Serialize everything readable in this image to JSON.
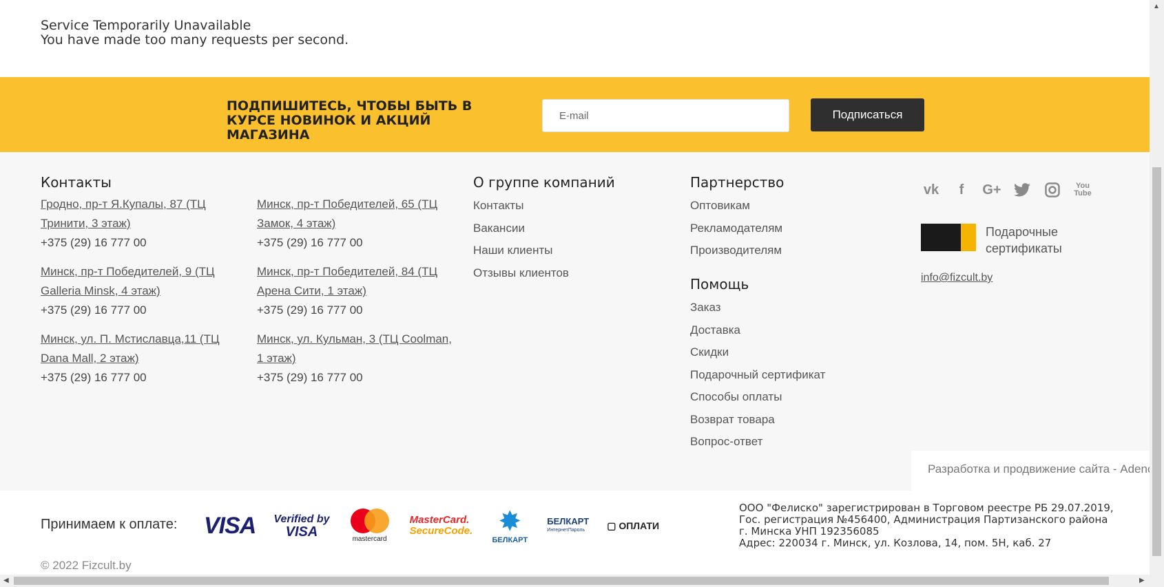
{
  "error": {
    "line1": "Service Temporarily Unavailable",
    "line2": "You have made too many requests per second."
  },
  "subscribe": {
    "title": "ПОДПИШИТЕСЬ, ЧТОБЫ БЫТЬ В КУРСЕ НОВИНОК И АКЦИЙ МАГАЗИНА",
    "email_placeholder": "E-mail",
    "button": "Подписаться",
    "bg_color": "#fbc02d"
  },
  "contacts": {
    "title": "Контакты",
    "stores": [
      {
        "address": "Гродно, пр-т Я.Купалы, 87 (ТЦ Тринити, 3 этаж)",
        "phone": "+375 (29) 16 777 00"
      },
      {
        "address": "Минск, пр-т Победителей, 65 (ТЦ Замок, 4 этаж)",
        "phone": "+375 (29) 16 777 00"
      },
      {
        "address": "Минск, пр-т Победителей, 9 (ТЦ Galleria Minsk, 4 этаж)",
        "phone": "+375 (29) 16 777 00"
      },
      {
        "address": "Минск, пр-т Победителей, 84 (ТЦ Арена Сити, 1 этаж)",
        "phone": "+375 (29) 16 777 00"
      },
      {
        "address": "Минск, ул. П. Мстиславца,11 (ТЦ Dana Mall, 2 этаж)",
        "phone": "+375 (29) 16 777 00"
      },
      {
        "address": "Минск, ул. Кульман, 3 (ТЦ Coolman, 1 этаж)",
        "phone": "+375 (29) 16 777 00"
      }
    ]
  },
  "about": {
    "title": "О группе компаний",
    "links": [
      "Контакты",
      "Вакансии",
      "Наши клиенты",
      "Отзывы клиентов"
    ]
  },
  "partnership": {
    "title": "Партнерство",
    "links": [
      "Оптовикам",
      "Рекламодателям",
      "Производителям"
    ]
  },
  "help": {
    "title": "Помощь",
    "links": [
      "Заказ",
      "Доставка",
      "Скидки",
      "Подарочный сертификат",
      "Способы оплаты",
      "Возврат товара",
      "Вопрос-ответ"
    ]
  },
  "social": {
    "icons": [
      "vk-icon",
      "facebook-icon",
      "google-plus-icon",
      "twitter-icon",
      "instagram-icon",
      "youtube-icon"
    ]
  },
  "gift": {
    "label": "Подарочные сертификаты"
  },
  "email": "info@fizcult.by",
  "developer": "Разработка и продвижение сайта - Adeno",
  "payment": {
    "label": "Принимаем к оплате:",
    "visa": "VISA",
    "vbv_top": "Verified by",
    "vbv_bottom": "VISA",
    "mastercard": "mastercard",
    "mcsc_top": "MasterCard.",
    "mcsc_bottom": "SecureCode.",
    "belkart": "БЕЛКАРТ",
    "belkart_pass": "БЕЛКАРТ",
    "belkart_pass_sub": "ИнтернетПароль",
    "oplati": "ОПЛАТИ"
  },
  "legal": {
    "line1": "ООО \"Фелиско\" зарегистрирован в Торговом реестре РБ 29.07.2019,",
    "line2": "Гос. регистрация №456400, Администрация Партизанского района",
    "line3": "г. Минска УНП 192356085",
    "line4": "Адрес: 220034 г. Минск, ул. Козлова, 14, пом. 5Н, каб. 27"
  },
  "copyright": "© 2022 Fizcult.by"
}
